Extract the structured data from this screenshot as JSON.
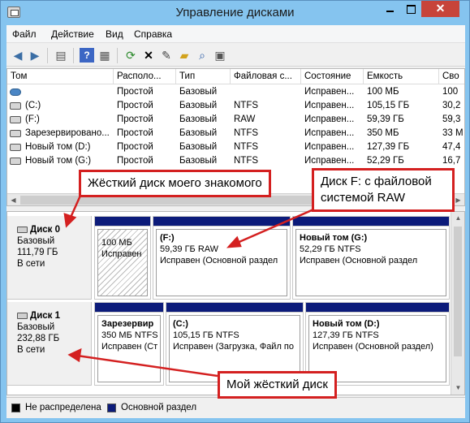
{
  "window": {
    "title": "Управление дисками",
    "close_glyph": "✕"
  },
  "menu": [
    "Файл",
    "Действие",
    "Вид",
    "Справка"
  ],
  "toolbar": {
    "icons": [
      "back-icon",
      "forward-icon",
      "console-tree-icon",
      "help-icon",
      "properties-icon",
      "refresh-icon",
      "delete-icon",
      "settings-icon",
      "open-folder-icon",
      "search-icon",
      "export-icon"
    ]
  },
  "volume_list": {
    "columns": [
      "Том",
      "Располо...",
      "Тип",
      "Файловая с...",
      "Состояние",
      "Емкость",
      "Сво"
    ],
    "rows": [
      {
        "name": "",
        "layout": "Простой",
        "type": "Базовый",
        "fs": "",
        "status": "Исправен...",
        "capacity": "100 МБ",
        "free": "100"
      },
      {
        "name": "(C:)",
        "layout": "Простой",
        "type": "Базовый",
        "fs": "NTFS",
        "status": "Исправен...",
        "capacity": "105,15 ГБ",
        "free": "30,2"
      },
      {
        "name": "(F:)",
        "layout": "Простой",
        "type": "Базовый",
        "fs": "RAW",
        "status": "Исправен...",
        "capacity": "59,39 ГБ",
        "free": "59,3"
      },
      {
        "name": "Зарезервировано...",
        "layout": "Простой",
        "type": "Базовый",
        "fs": "NTFS",
        "status": "Исправен...",
        "capacity": "350 МБ",
        "free": "33 М"
      },
      {
        "name": "Новый том (D:)",
        "layout": "Простой",
        "type": "Базовый",
        "fs": "NTFS",
        "status": "Исправен...",
        "capacity": "127,39 ГБ",
        "free": "47,4"
      },
      {
        "name": "Новый том (G:)",
        "layout": "Простой",
        "type": "Базовый",
        "fs": "NTFS",
        "status": "Исправен...",
        "capacity": "52,29 ГБ",
        "free": "16,7"
      }
    ]
  },
  "disks": [
    {
      "name": "Диск 0",
      "type": "Базовый",
      "size": "111,79 ГБ",
      "state": "В сети",
      "partitions": [
        {
          "name": "",
          "size": "100 МБ",
          "status": "Исправен"
        },
        {
          "name": "(F:)",
          "size": "59,39 ГБ RAW",
          "status": "Исправен (Основной раздел"
        },
        {
          "name": "Новый том  (G:)",
          "size": "52,29 ГБ NTFS",
          "status": "Исправен (Основной раздел"
        }
      ]
    },
    {
      "name": "Диск 1",
      "type": "Базовый",
      "size": "232,88 ГБ",
      "state": "В сети",
      "partitions": [
        {
          "name": "Зарезервир",
          "size": "350 МБ NTFS",
          "status": "Исправен (Ст"
        },
        {
          "name": "(C:)",
          "size": "105,15 ГБ NTFS",
          "status": "Исправен (Загрузка, Файл по"
        },
        {
          "name": "Новый том  (D:)",
          "size": "127,39 ГБ NTFS",
          "status": "Исправен (Основной раздел)"
        }
      ]
    }
  ],
  "legend": {
    "unallocated": "Не распределена",
    "primary": "Основной раздел",
    "unallocated_color": "#000000",
    "primary_color": "#0c1b7a"
  },
  "annotations": {
    "callout1": "Жёсткий диск моего знакомого",
    "callout2_line1": "Диск F: с файловой",
    "callout2_line2": "системой RAW",
    "callout3": "Мой жёсткий диск",
    "color": "#d42020"
  }
}
